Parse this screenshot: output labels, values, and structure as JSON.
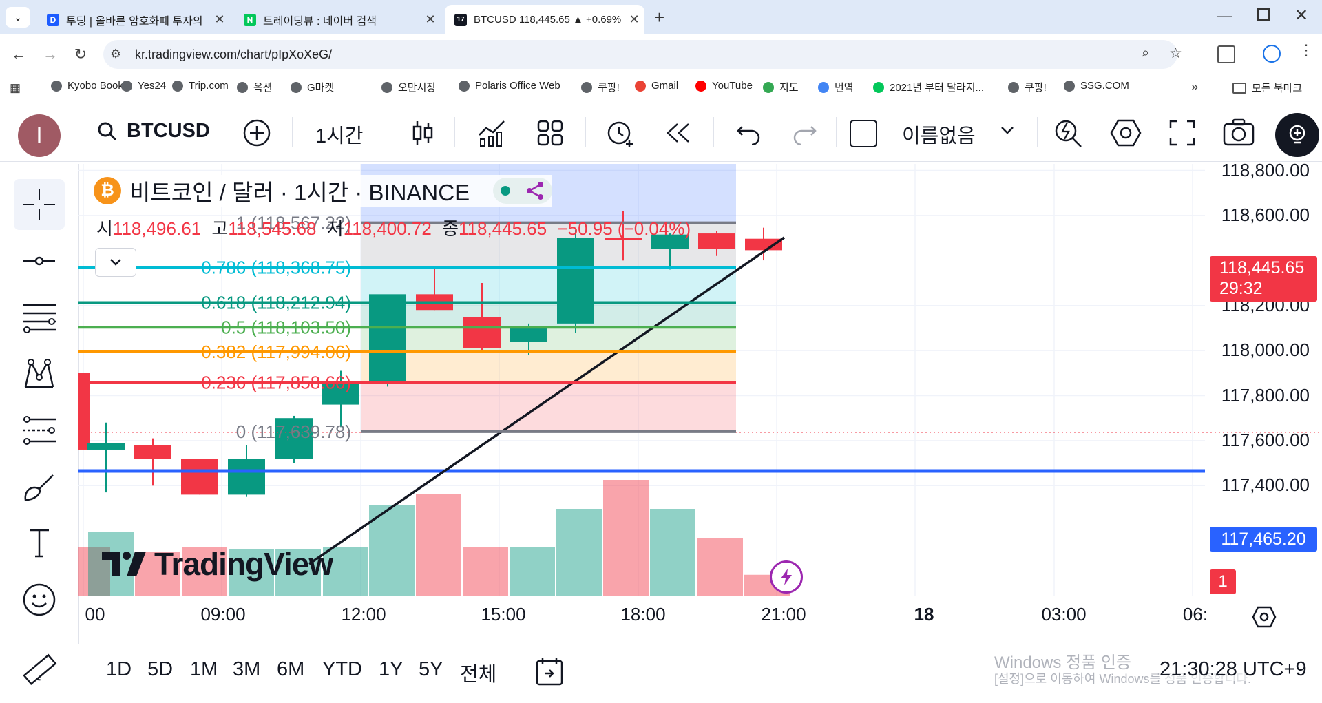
{
  "browser": {
    "tabs": [
      {
        "title": "투딩 | 올바른 암호화폐 투자의",
        "favicon": "D",
        "color": "#1d5cff"
      },
      {
        "title": "트레이딩뷰 : 네이버 검색",
        "favicon": "N",
        "color": "#03c75a"
      },
      {
        "title": "BTCUSD 118,445.65 ▲ +0.69%",
        "favicon": "17",
        "color": "#131722"
      }
    ],
    "url": "kr.tradingview.com/chart/pIpXoXeG/",
    "bookmarks": [
      "Kyobo Book",
      "Yes24",
      "Trip.com",
      "옥션",
      "G마켓",
      "오만시장",
      "Polaris Office Web",
      "쿠팡!",
      "Gmail",
      "YouTube",
      "지도",
      "번역",
      "2021년 부터 달라지...",
      "쿠팡!",
      "SSG.COM"
    ],
    "all_bookmarks": "모든 북마크"
  },
  "toolbar": {
    "avatar": "I",
    "symbol": "BTCUSD",
    "interval": "1시간",
    "layout_name": "이름없음"
  },
  "legend": {
    "title": "비트코인 / 달러 · 1시간 · BINANCE",
    "o_label": "시",
    "o": "118,496.61",
    "h_label": "고",
    "h": "118,545.68",
    "l_label": "저",
    "l": "118,400.72",
    "c_label": "종",
    "c": "118,445.65",
    "change": "−50.95 (−0.04%)"
  },
  "chart_data": {
    "type": "candlestick",
    "symbol": "BTCUSD",
    "interval": "1h",
    "ylim": [
      117310,
      118810
    ],
    "x_ticks": [
      "00",
      "09:00",
      "12:00",
      "15:00",
      "18:00",
      "21:00",
      "18",
      "03:00",
      "06:"
    ],
    "y_ticks": [
      "118,800.00",
      "118,600.00",
      "118,200.00",
      "118,000.00",
      "117,800.00",
      "117,600.00",
      "117,400.00"
    ],
    "candles": [
      {
        "o": 117900,
        "h": 117900,
        "l": 117560,
        "c": 117560
      },
      {
        "o": 117560,
        "h": 117680,
        "l": 117370,
        "c": 117590
      },
      {
        "o": 117580,
        "h": 117610,
        "l": 117400,
        "c": 117520
      },
      {
        "o": 117520,
        "h": 117520,
        "l": 117360,
        "c": 117360
      },
      {
        "o": 117360,
        "h": 117580,
        "l": 117350,
        "c": 117520
      },
      {
        "o": 117520,
        "h": 117710,
        "l": 117500,
        "c": 117700
      },
      {
        "o": 117760,
        "h": 117910,
        "l": 117660,
        "c": 117860
      },
      {
        "o": 117860,
        "h": 118230,
        "l": 117840,
        "c": 118250
      },
      {
        "o": 118250,
        "h": 118370,
        "l": 118180,
        "c": 118180
      },
      {
        "o": 118150,
        "h": 118300,
        "l": 117990,
        "c": 118010
      },
      {
        "o": 118040,
        "h": 118120,
        "l": 117980,
        "c": 118110
      },
      {
        "o": 118120,
        "h": 118535,
        "l": 118080,
        "c": 118500
      },
      {
        "o": 118500,
        "h": 118620,
        "l": 118400,
        "c": 118490
      },
      {
        "o": 118450,
        "h": 118520,
        "l": 118360,
        "c": 118515
      },
      {
        "o": 118520,
        "h": 118530,
        "l": 118420,
        "c": 118450
      },
      {
        "o": 118496.61,
        "h": 118545.68,
        "l": 118400.72,
        "c": 118445.65
      }
    ],
    "volume_rel": [
      0.42,
      0.55,
      0.38,
      0.42,
      0.4,
      0.4,
      0.42,
      0.78,
      0.88,
      0.42,
      0.42,
      0.75,
      1.0,
      0.75,
      0.5,
      0.18
    ],
    "fibonacci": [
      {
        "level": "1",
        "label": "1 (118,567.22)",
        "value": 118567.22,
        "color": "#787b86"
      },
      {
        "level": "0.786",
        "label": "0.786 (118,368.75)",
        "value": 118368.75,
        "color": "#00bcd4"
      },
      {
        "level": "0.618",
        "label": "0.618 (118,212.94)",
        "value": 118212.94,
        "color": "#089981"
      },
      {
        "level": "0.5",
        "label": "0.5 (118,103.50)",
        "value": 118103.5,
        "color": "#4caf50"
      },
      {
        "level": "0.382",
        "label": "0.382 (117,994.06)",
        "value": 117994.06,
        "color": "#ff9800"
      },
      {
        "level": "0.236",
        "label": "0.236 (117,858.66)",
        "value": 117858.66,
        "color": "#f23645"
      },
      {
        "level": "0",
        "label": "0 (117,639.78)",
        "value": 117639.78,
        "color": "#787b86"
      }
    ],
    "horizontal_line": {
      "value": 117465.2,
      "label": "117,465.20",
      "color": "#2962ff"
    },
    "last_price": {
      "label": "118,445.65",
      "countdown": "29:32",
      "color": "#f23645"
    },
    "alert_badge": "1"
  },
  "bottom": {
    "ranges": [
      "1D",
      "5D",
      "1M",
      "3M",
      "6M",
      "YTD",
      "1Y",
      "5Y",
      "전체"
    ],
    "clock": "21:30:28 UTC+9"
  },
  "watermark": {
    "logo": "TradingView",
    "windows_line1": "Windows 정품 인증",
    "windows_line2": "[설정]으로 이동하여 Windows를 정품 인증합니다."
  }
}
